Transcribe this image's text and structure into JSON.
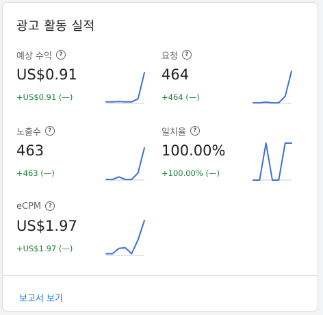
{
  "card": {
    "title": "광고 활동 실적"
  },
  "metrics": [
    {
      "label": "예상 수익",
      "value": "US$0.91",
      "change": "+US$0.91 (—)",
      "trend": [
        0.05,
        0.05,
        0.06,
        0.05,
        0.05,
        0.15,
        1.0
      ]
    },
    {
      "label": "요청",
      "value": "464",
      "change": "+464 (—)",
      "trend": [
        0.02,
        0.02,
        0.04,
        0.02,
        0.02,
        0.22,
        1.0
      ]
    },
    {
      "label": "노출수",
      "value": "463",
      "change": "+463 (—)",
      "trend": [
        0.02,
        0.02,
        0.1,
        0.02,
        0.02,
        0.22,
        1.0
      ]
    },
    {
      "label": "일치율",
      "value": "100.00%",
      "change": "+100.00% (—)",
      "trend": [
        0,
        0,
        1.0,
        0,
        0,
        1.0,
        1.0
      ]
    },
    {
      "label": "eCPM",
      "value": "US$1.97",
      "change": "+US$1.97 (—)",
      "trend": [
        0.05,
        0.05,
        0.2,
        0.22,
        0.05,
        0.45,
        1.0
      ]
    }
  ],
  "footer": {
    "link_label": "보고서 보기"
  },
  "colors": {
    "accent": "#1a73e8",
    "sparkline": "#3c6fd6",
    "positive": "#188038"
  }
}
